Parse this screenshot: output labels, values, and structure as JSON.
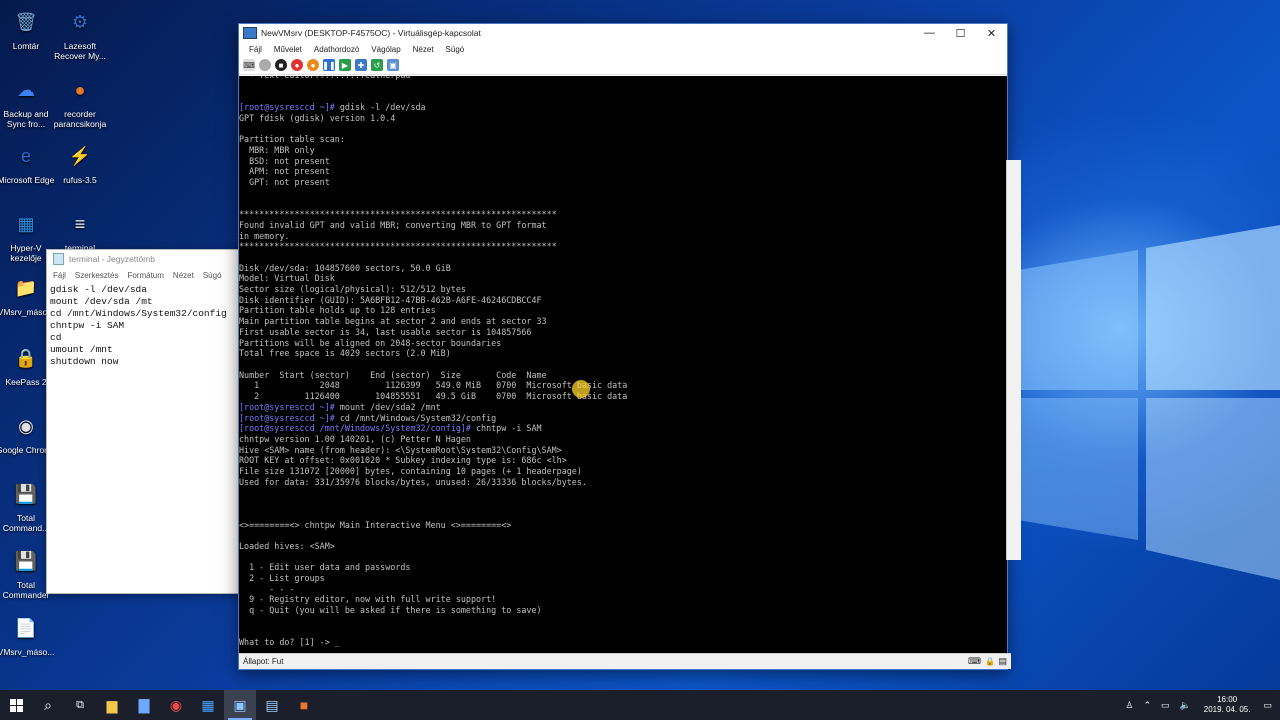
{
  "desktop": {
    "icons": [
      {
        "label": "Lomtár",
        "glyph": "🗑",
        "color": "#6fa8dc"
      },
      {
        "label": "Lazesoft Recover My...",
        "glyph": "⚙",
        "color": "#2a6fd1"
      },
      {
        "label": "Backup and Sync fro...",
        "glyph": "☁",
        "color": "#3b82f6"
      },
      {
        "label": "recorder parancsikonja",
        "glyph": "●",
        "color": "#e8772e"
      },
      {
        "label": "Microsoft Edge",
        "glyph": "e",
        "color": "#1f6fd6"
      },
      {
        "label": "rufus-3.5",
        "glyph": "⚡",
        "color": "#6b7280"
      },
      {
        "label": "Hyper-V kezelője",
        "glyph": "▦",
        "color": "#2f8ee0"
      },
      {
        "label": "terminal",
        "glyph": "≡",
        "color": "#f5f5f5"
      },
      {
        "label": "VMsrv_máso...",
        "glyph": "📁",
        "color": "#f2c94c"
      },
      {
        "label": "KeePass 2",
        "glyph": "🔒",
        "color": "#2d5fa8"
      },
      {
        "label": "Google Chrome",
        "glyph": "◉",
        "color": "#e0e0e0"
      },
      {
        "label": "Total Command...",
        "glyph": "💾",
        "color": "#1f4fa8"
      },
      {
        "label": "Total Commander",
        "glyph": "💾",
        "color": "#1f4fa8"
      },
      {
        "label": "VMsrv_máso...",
        "glyph": "📄",
        "color": "#f5f5f5"
      }
    ]
  },
  "notepad": {
    "title": "terminal - Jegyzettömb",
    "menu": [
      "Fájl",
      "Szerkesztés",
      "Formátum",
      "Nézet",
      "Súgó"
    ],
    "content": "gdisk -l /dev/sda\nmount /dev/sda /mt\ncd /mnt/Windows/System32/config\nchntpw -i SAM\ncd\numount /mnt\nshutdown now"
  },
  "vm": {
    "title": "NewVMsrv (DESKTOP-F4575OC) - Virtuálisgép-kapcsolat",
    "menu": [
      "Fájl",
      "Művelet",
      "Adathordozó",
      "Vágólap",
      "Nézet",
      "Súgó"
    ],
    "status": "Állapot: Fut",
    "terminal": "  - Text editor:........featherpad\n\n\n[root@sysresccd ~]# gdisk -l /dev/sda\nGPT fdisk (gdisk) version 1.0.4\n\nPartition table scan:\n  MBR: MBR only\n  BSD: not present\n  APM: not present\n  GPT: not present\n\n\n***************************************************************\nFound invalid GPT and valid MBR; converting MBR to GPT format\nin memory.\n***************************************************************\n\nDisk /dev/sda: 104857600 sectors, 50.0 GiB\nModel: Virtual Disk\nSector size (logical/physical): 512/512 bytes\nDisk identifier (GUID): 5A6BFB12-47BB-462B-A6FE-46246CDBCC4F\nPartition table holds up to 128 entries\nMain partition table begins at sector 2 and ends at sector 33\nFirst usable sector is 34, last usable sector is 104857566\nPartitions will be aligned on 2048-sector boundaries\nTotal free space is 4029 sectors (2.0 MiB)\n\nNumber  Start (sector)    End (sector)  Size       Code  Name\n   1            2048         1126399   549.0 MiB   0700  Microsoft basic data\n   2         1126400       104855551   49.5 GiB    0700  Microsoft basic data\n[root@sysresccd ~]# mount /dev/sda2 /mnt\n[root@sysresccd ~]# cd /mnt/Windows/System32/config\n[root@sysresccd /mnt/Windows/System32/config]# chntpw -i SAM\nchntpw version 1.00 140201, (c) Petter N Hagen\nHive <SAM> name (from header): <\\SystemRoot\\System32\\Config\\SAM>\nROOT KEY at offset: 0x001020 * Subkey indexing type is: 686c <lh>\nFile size 131072 [20000] bytes, containing 10 pages (+ 1 headerpage)\nUsed for data: 331/35976 blocks/bytes, unused: 26/33336 blocks/bytes.\n\n\n\n<>========<> chntpw Main Interactive Menu <>========<>\n\nLoaded hives: <SAM>\n\n  1 - Edit user data and passwords\n  2 - List groups\n      - - -\n  9 - Registry editor, now with full write support!\n  q - Quit (you will be asked if there is something to save)\n\n\nWhat to do? [1] -> _"
  },
  "taskbar": {
    "clock_time": "16:00",
    "clock_date": "2019. 04. 05."
  },
  "colors": {
    "prompt": "#7b7bff",
    "terminal_text": "#c0c0c0",
    "taskbar": "#1a1f2b"
  }
}
